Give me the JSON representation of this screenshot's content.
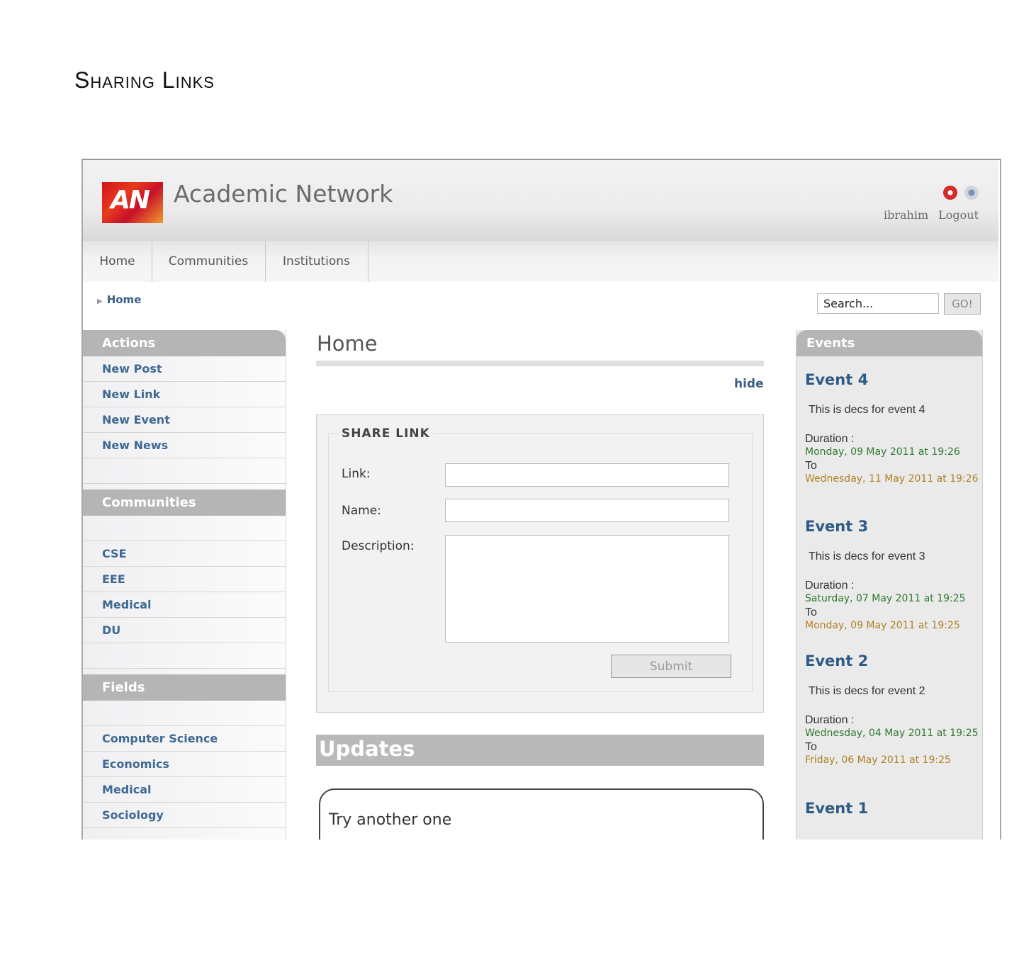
{
  "document": {
    "heading": "Sharing Links"
  },
  "header": {
    "logo_text": "AN",
    "app_title": "Academic Network",
    "icons": [
      "help-icon",
      "settings-icon"
    ],
    "username": "ibrahim",
    "logout_label": "Logout"
  },
  "nav": {
    "items": [
      {
        "label": "Home"
      },
      {
        "label": "Communities"
      },
      {
        "label": "Institutions"
      }
    ]
  },
  "breadcrumb": {
    "current": "Home"
  },
  "search": {
    "value": "Search...",
    "button_label": "GO!"
  },
  "sidebar": {
    "actions": {
      "heading": "Actions",
      "items": [
        "New Post",
        "New Link",
        "New Event",
        "New News"
      ]
    },
    "communities": {
      "heading": "Communities",
      "items": [
        "CSE",
        "EEE",
        "Medical",
        "DU"
      ]
    },
    "fields": {
      "heading": "Fields",
      "items": [
        "Computer Science",
        "Economics",
        "Medical",
        "Sociology"
      ]
    }
  },
  "main": {
    "title": "Home",
    "hide_label": "hide",
    "share_form": {
      "legend": "SHARE LINK",
      "link_label": "Link:",
      "link_value": "",
      "name_label": "Name:",
      "name_value": "",
      "description_label": "Description:",
      "description_value": "",
      "submit_label": "Submit"
    },
    "updates_heading": "Updates",
    "update_text": "Try another one"
  },
  "events": {
    "heading": "Events",
    "items": [
      {
        "title": "Event 4",
        "desc": "This is decs for event 4",
        "duration_label": "Duration :",
        "start": "Monday, 09 May 2011 at 19:26",
        "to_label": "To",
        "end": "Wednesday, 11 May 2011 at 19:26"
      },
      {
        "title": "Event 3",
        "desc": "This is decs for event 3",
        "duration_label": "Duration :",
        "start": "Saturday, 07 May 2011 at 19:25",
        "to_label": "To",
        "end": "Monday, 09 May 2011 at 19:25"
      },
      {
        "title": "Event 2",
        "desc": "This is decs for event 2",
        "duration_label": "Duration :",
        "start": "Wednesday, 04 May 2011 at 19:25",
        "to_label": "To",
        "end": "Friday, 06 May 2011 at 19:25"
      },
      {
        "title": "Event 1"
      }
    ]
  },
  "colors": {
    "link_blue": "#3f6992",
    "heading_gray": "#b5b5b5",
    "start_green": "#2f7a2f",
    "end_orange": "#b08023"
  }
}
